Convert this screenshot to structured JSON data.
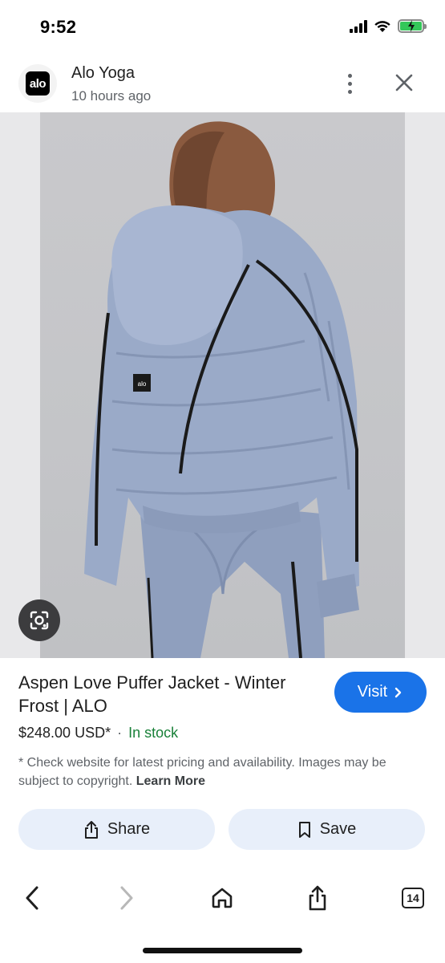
{
  "status_bar": {
    "time": "9:52",
    "icons": [
      "cellular-signal-icon",
      "wifi-icon",
      "battery-charging-icon"
    ],
    "battery_color": "#34c759"
  },
  "header": {
    "logo_text": "alo",
    "source_name": "Alo Yoga",
    "posted_time": "10 hours ago",
    "icons": [
      "more-vert-icon",
      "close-icon"
    ]
  },
  "image": {
    "alt": "Aspen Love Puffer Jacket - Winter Frost",
    "badge_text": "alo",
    "jacket_color": "#9aaac8"
  },
  "product": {
    "title": "Aspen Love Puffer Jacket - Winter Frost | ALO",
    "price": "$248.00 USD*",
    "separator": "·",
    "stock": "In stock",
    "stock_color": "#188038",
    "disclaimer": "* Check website for latest pricing and availability. Images may be subject to copyright.",
    "learn_more": "Learn More"
  },
  "buttons": {
    "visit": "Visit",
    "share": "Share",
    "save": "Save",
    "accent_color": "#1a73e8"
  },
  "bottom_nav": {
    "tab_count": "14",
    "icons": [
      "back-icon",
      "forward-icon",
      "home-icon",
      "share-icon",
      "tabs-icon"
    ]
  }
}
